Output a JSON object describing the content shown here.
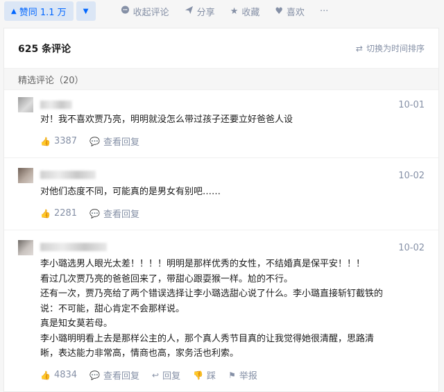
{
  "topbar": {
    "vote_up_label": "赞同 1.1 万",
    "vote_down_icon": "triangle-down-icon",
    "actions": [
      {
        "icon": "comment-icon",
        "label": "收起评论"
      },
      {
        "icon": "share-icon",
        "label": "分享"
      },
      {
        "icon": "star-icon",
        "label": "收藏"
      },
      {
        "icon": "heart-icon",
        "label": "喜欢"
      },
      {
        "icon": "more-icon",
        "label": "···"
      }
    ]
  },
  "comments_header": {
    "count": "625 条评论",
    "sort_label": "切换为时间排序"
  },
  "section_label": "精选评论（20）",
  "comments": [
    {
      "date": "10-01",
      "lines": [
        "对！我不喜欢贾乃亮，明明就没怎么带过孩子还要立好爸爸人设"
      ],
      "likes": "3387",
      "view_reply": "查看回复"
    },
    {
      "date": "10-02",
      "lines": [
        "对他们态度不同，可能真的是男女有别吧……"
      ],
      "likes": "2281",
      "view_reply": "查看回复"
    },
    {
      "date": "10-02",
      "lines": [
        "李小璐选男人眼光太差！！！！明明是那样优秀的女性，不结婚真是保平安！！！",
        "看过几次贾乃亮的爸爸回来了，带甜心跟耍猴一样。尬的不行。",
        "还有一次，贾乃亮给了两个错误选择让李小璐选甜心说了什么。李小璐直接斩钉截铁的",
        "说：不可能，甜心肯定不会那样说。",
        "真是知女莫若母。",
        "李小璐明明看上去是那样公主的人，那个真人秀节目真的让我觉得她很清醒，思路清",
        "晰，表达能力非常高，情商也高，家务活也利索。"
      ],
      "likes": "4834",
      "view_reply": "查看回复",
      "reply": "回复",
      "dislike": "踩",
      "report": "举报"
    }
  ],
  "colors": {
    "accent": "#0066ff",
    "accent_bg": "#dbe6f5",
    "muted": "#8590a6"
  }
}
